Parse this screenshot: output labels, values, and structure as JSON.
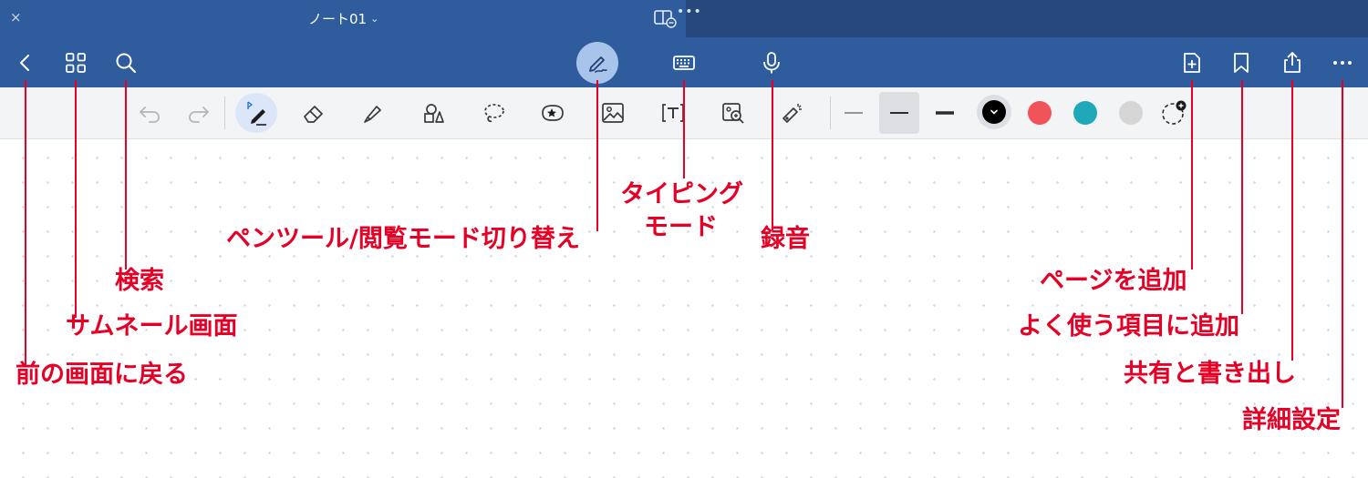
{
  "titlebar": {
    "close_glyph": "×",
    "doc_title": "ノート01",
    "chevron": "⌄",
    "more": "•••"
  },
  "navbar": {
    "icons": [
      "back-icon",
      "thumbnail-grid-icon",
      "search-icon",
      "pen-icon",
      "keyboard-icon",
      "microphone-icon",
      "add-page-icon",
      "bookmark-icon",
      "share-icon",
      "more-icon"
    ]
  },
  "toolbar": {
    "colors": {
      "black": "#000000",
      "red": "#f0545a",
      "teal": "#1ea8b8",
      "gray": "#d6d6d6"
    }
  },
  "callouts": {
    "back": "前の画面に戻る",
    "thumbnails": "サムネール画面",
    "search": "検索",
    "pen_mode": "ペンツール/閲覧モード切り替え",
    "typing_line1": "タイピング",
    "typing_line2": "モード",
    "recording": "録音",
    "add_page": "ページを追加",
    "favorites": "よく使う項目に追加",
    "share_export": "共有と書き出し",
    "settings": "詳細設定"
  },
  "accent": {
    "callout_color": "#e60026",
    "bar_color": "#2f5c9c"
  }
}
